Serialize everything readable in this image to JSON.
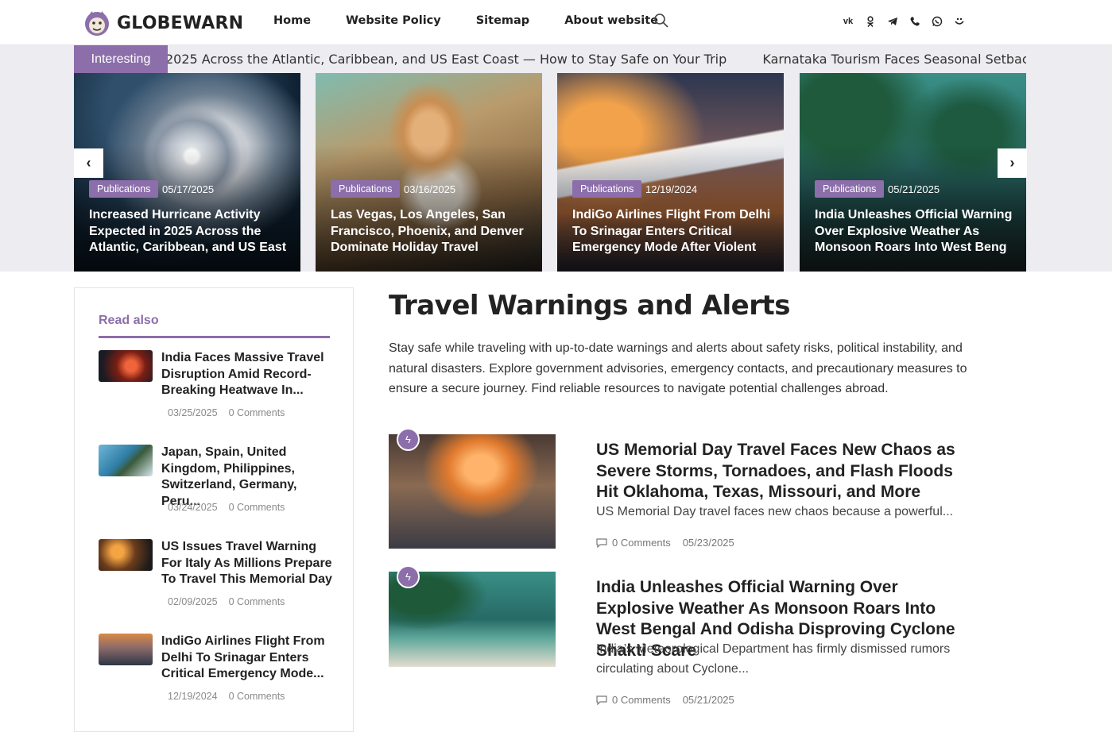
{
  "site": {
    "name": "GLOBEWARN"
  },
  "nav": {
    "items": [
      "Home",
      "Website Policy",
      "Sitemap",
      "About website"
    ]
  },
  "socials": [
    "vk-icon",
    "odnoklassniki-icon",
    "telegram-icon",
    "viber-icon",
    "whatsapp-icon",
    "max-icon"
  ],
  "ticker": {
    "label": "Interesting",
    "items": [
      "2025 Across the Atlantic, Caribbean, and US East Coast — How to Stay Safe on Your Trip",
      "Karnataka Tourism Faces Seasonal Setback as Udupi’s M"
    ]
  },
  "slides": [
    {
      "category": "Publications",
      "date": "05/17/2025",
      "title": "Increased Hurricane Activity Expected in 2025 Across the Atlantic, Caribbean, and US East"
    },
    {
      "category": "Publications",
      "date": "03/16/2025",
      "title": "Las Vegas, Los Angeles, San Francisco, Phoenix, and Denver Dominate Holiday Travel"
    },
    {
      "category": "Publications",
      "date": "12/19/2024",
      "title": "IndiGo Airlines Flight From Delhi To Srinagar Enters Critical Emergency Mode After Violent"
    },
    {
      "category": "Publications",
      "date": "05/21/2025",
      "title": "India Unleashes Official Warning Over Explosive Weather As Monsoon Roars Into West Beng"
    }
  ],
  "carousel": {
    "prev": "‹",
    "next": "›"
  },
  "sidebar": {
    "heading": "Read also",
    "items": [
      {
        "title": "India Faces Massive Travel Disruption Amid Record-Breaking Heatwave In...",
        "date": "03/25/2025",
        "comments": "0 Comments"
      },
      {
        "title": "Japan, Spain, United Kingdom, Philippines, Switzerland, Germany, Peru...",
        "date": "03/24/2025",
        "comments": "0 Comments"
      },
      {
        "title": "US Issues Travel Warning For Italy As Millions Prepare To Travel This Memorial Day",
        "date": "02/09/2025",
        "comments": "0 Comments"
      },
      {
        "title": "IndiGo Airlines Flight From Delhi To Srinagar Enters Critical Emergency Mode...",
        "date": "12/19/2024",
        "comments": "0 Comments"
      }
    ]
  },
  "main": {
    "title": "Travel Warnings and Alerts",
    "description": "Stay safe while traveling with up-to-date warnings and alerts about safety risks, political instability, and natural disasters. Explore government advisories, emergency contacts, and precautionary measures to ensure a secure journey. Find reliable resources to navigate potential challenges abroad.",
    "posts": [
      {
        "title": "US Memorial Day Travel Faces New Chaos as Severe Storms, Tornadoes, and Flash Floods Hit Oklahoma, Texas, Missouri, and More",
        "excerpt": "US Memorial Day travel faces new chaos because a powerful...",
        "comments": "0 Comments",
        "date": "05/23/2025"
      },
      {
        "title": "India Unleashes Official Warning Over Explosive Weather As Monsoon Roars Into West Bengal And Odisha Disproving Cyclone Shakti Scare",
        "excerpt": "India’s Meteorological Department has firmly dismissed rumors circulating about Cyclone...",
        "comments": "0 Comments",
        "date": "05/21/2025"
      }
    ]
  },
  "colors": {
    "accent": "#8c6eaa",
    "band": "#ececf1"
  }
}
